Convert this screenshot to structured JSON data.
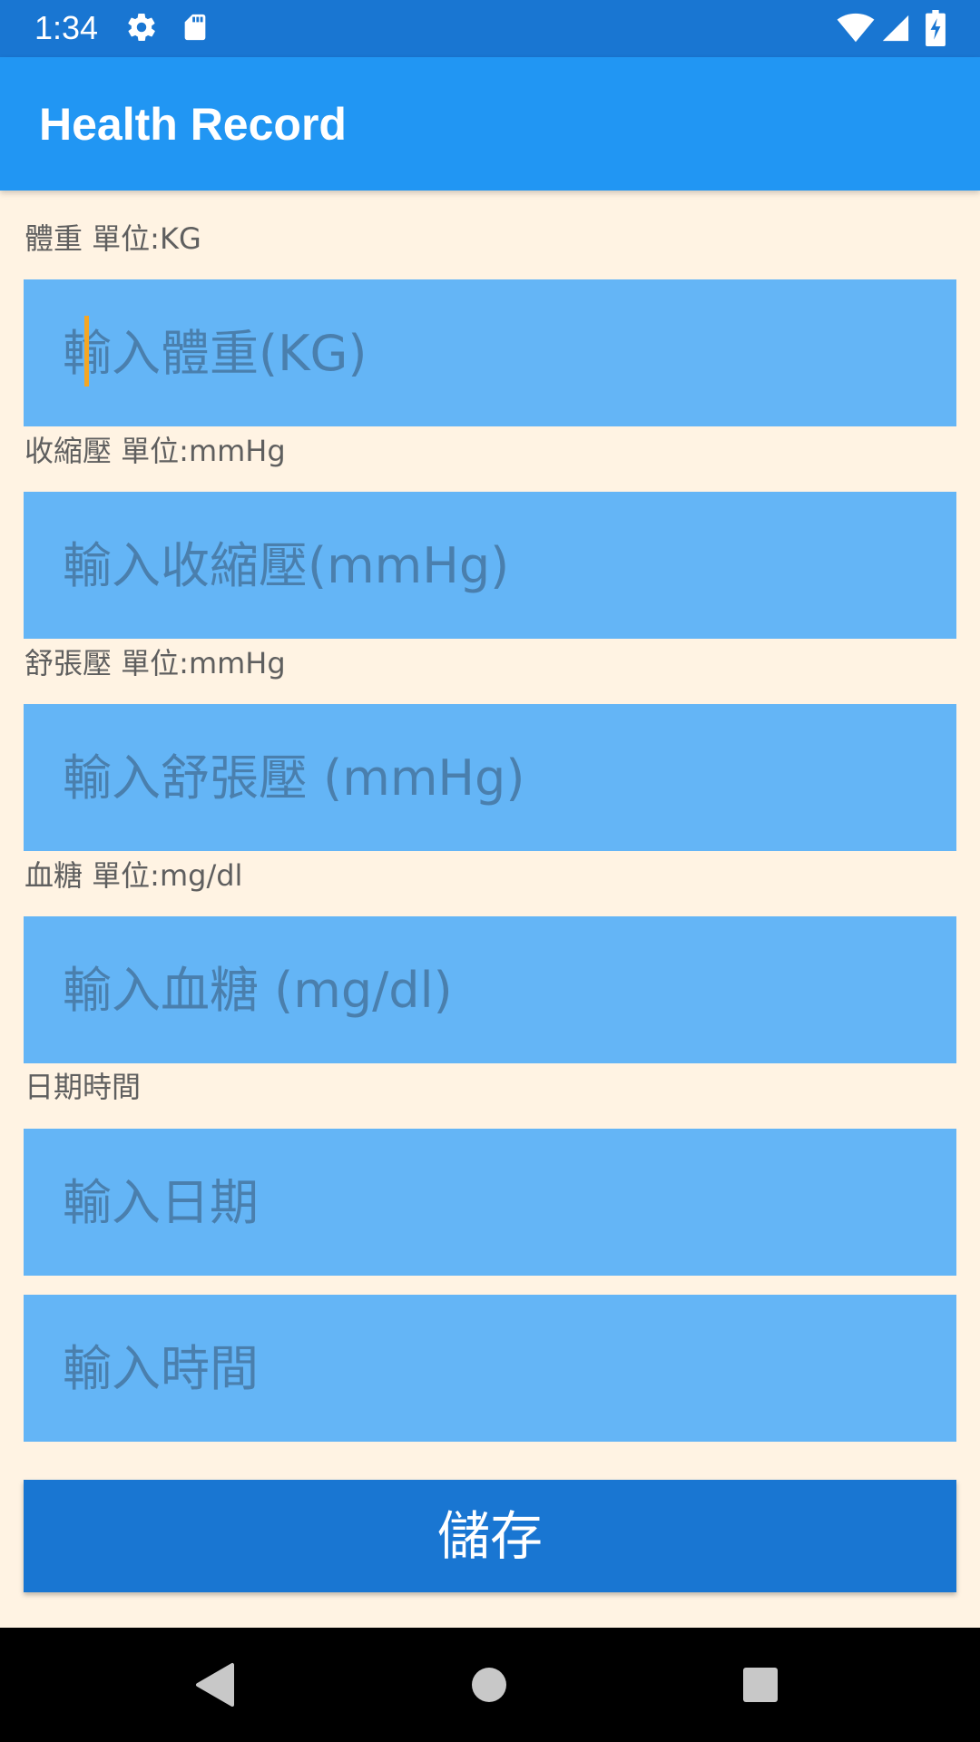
{
  "status_bar": {
    "time": "1:34",
    "icons": [
      "gear-icon",
      "sd-card-icon",
      "wifi-icon",
      "cellular-signal-icon",
      "battery-charging-icon"
    ]
  },
  "app_bar": {
    "title": "Health Record"
  },
  "form": {
    "weight": {
      "label": "體重 單位:KG",
      "placeholder": "輸入體重(KG)",
      "focused": true
    },
    "systolic": {
      "label": "收縮壓 單位:mmHg",
      "placeholder": "輸入收縮壓(mmHg)"
    },
    "diastolic": {
      "label": "舒張壓 單位:mmHg",
      "placeholder": "輸入舒張壓 (mmHg)"
    },
    "blood_sugar": {
      "label": "血糖 單位:mg/dl",
      "placeholder": "輸入血糖 (mg/dl)"
    },
    "datetime": {
      "label": "日期時間",
      "date_placeholder": "輸入日期",
      "time_placeholder": "輸入時間"
    },
    "save_label": "儲存"
  },
  "nav_bar": {
    "icons": [
      "back-icon",
      "home-icon",
      "recents-icon"
    ]
  },
  "colors": {
    "status_bar": "#1976D2",
    "app_bar": "#2196F3",
    "background": "#FFF3E3",
    "field": "#64B5F6",
    "button": "#1976D2",
    "cursor": "#F5A623"
  }
}
